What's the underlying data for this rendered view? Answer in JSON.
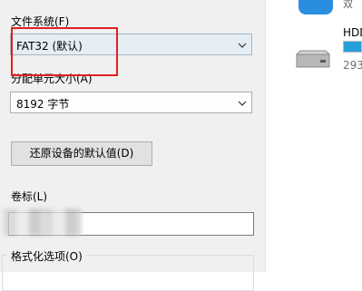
{
  "dialog": {
    "filesystem_label": "文件系统(F)",
    "filesystem_value": "FAT32 (默认)",
    "alloc_label": "分配单元大小(A)",
    "alloc_value": "8192 字节",
    "restore_button": "还原设备的默认值(D)",
    "volume_label": "卷标(L)",
    "volume_value": "",
    "format_options_label": "格式化选项(O)"
  },
  "right_panel": {
    "app_name_partial": "双",
    "drive_name": "HDD",
    "drive_size_partial": "293",
    "drive_usage_percent": 100,
    "accent_color": "#26a0da"
  }
}
